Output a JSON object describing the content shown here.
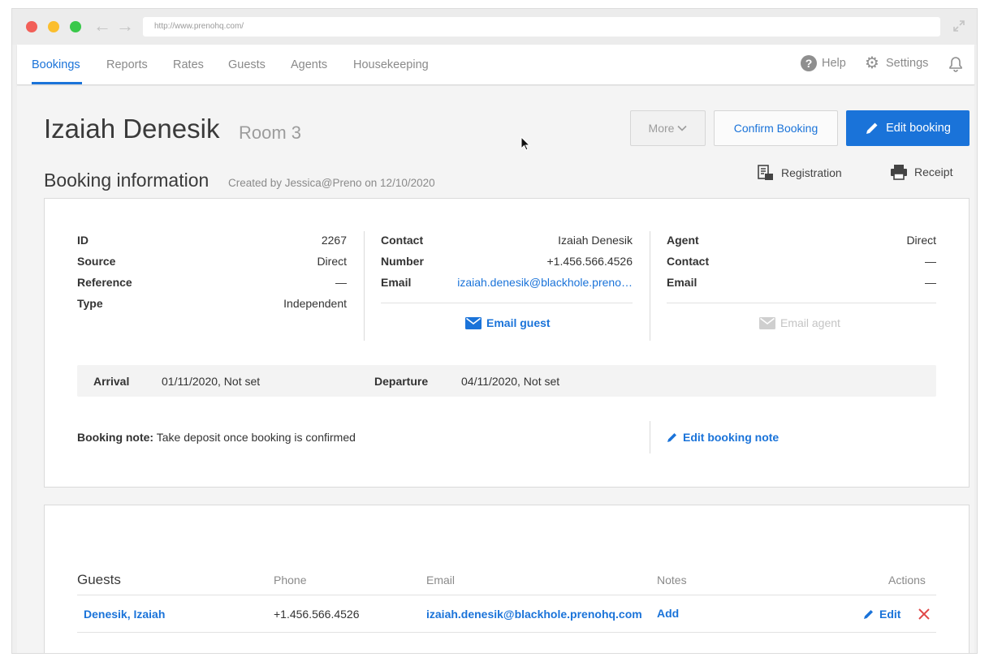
{
  "browser": {
    "url": "http://www.prenohq.com/"
  },
  "nav": {
    "tabs": [
      "Bookings",
      "Reports",
      "Rates",
      "Guests",
      "Agents",
      "Housekeeping"
    ],
    "help_label": "Help",
    "settings_label": "Settings"
  },
  "header": {
    "guest_name": "Izaiah Denesik",
    "room": "Room 3",
    "more_label": "More",
    "confirm_label": "Confirm Booking",
    "edit_label": "Edit booking"
  },
  "booking_info": {
    "title": "Booking information",
    "created_by": "Created by Jessica@Preno on 12/10/2020",
    "registration_label": "Registration",
    "receipt_label": "Receipt",
    "left": [
      {
        "label": "ID",
        "value": "2267"
      },
      {
        "label": "Source",
        "value": "Direct"
      },
      {
        "label": "Reference",
        "value": "—"
      },
      {
        "label": "Type",
        "value": "Independent"
      }
    ],
    "contact": [
      {
        "label": "Contact",
        "value": "Izaiah Denesik"
      },
      {
        "label": "Number",
        "value": "+1.456.566.4526"
      },
      {
        "label": "Email",
        "value": "izaiah.denesik@blackhole.preno…"
      }
    ],
    "agent": [
      {
        "label": "Agent",
        "value": "Direct"
      },
      {
        "label": "Contact",
        "value": "—"
      },
      {
        "label": "Email",
        "value": "—"
      }
    ],
    "email_guest_label": "Email guest",
    "email_agent_label": "Email agent",
    "arrival_label": "Arrival",
    "arrival_value": "01/11/2020, Not set",
    "departure_label": "Departure",
    "departure_value": "04/11/2020, Not set",
    "note_label": "Booking note:",
    "note_text": "Take deposit once booking is confirmed",
    "edit_note_label": "Edit booking note"
  },
  "guests_table": {
    "headers": [
      "Guests",
      "Phone",
      "Email",
      "Notes",
      "Actions"
    ],
    "rows": [
      {
        "name": "Denesik, Izaiah",
        "phone": "+1.456.566.4526",
        "email": "izaiah.denesik@blackhole.prenohq.com",
        "notes": "Add",
        "edit": "Edit"
      }
    ]
  },
  "colors": {
    "accent": "#1a73d9",
    "danger": "#e04848"
  }
}
